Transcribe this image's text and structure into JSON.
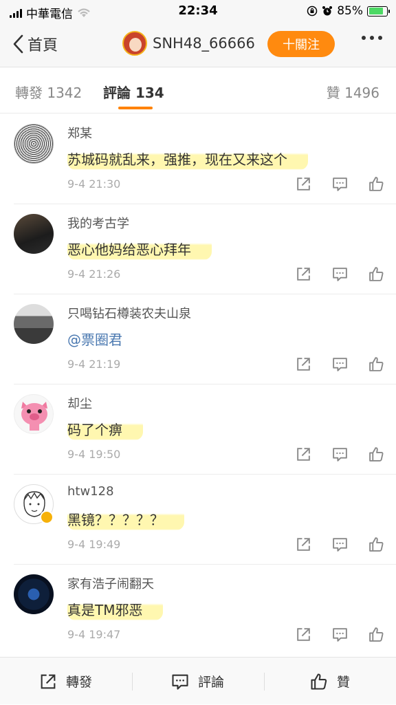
{
  "status_bar": {
    "carrier": "中華電信",
    "time": "22:34",
    "battery": "85%"
  },
  "nav": {
    "back_label": "首頁",
    "username": "SNH48_66666",
    "follow_label": "十關注"
  },
  "tabs": [
    {
      "label": "轉發 1342"
    },
    {
      "label": "評論 134"
    },
    {
      "label": "贊 1496"
    }
  ],
  "comments": [
    {
      "name": "郑某",
      "text": "苏城码就乱来，强推，现在又来这个",
      "time": "9-4 21:30"
    },
    {
      "name": "我的考古学",
      "text": "恶心他妈给恶心拜年",
      "time": "9-4 21:26"
    },
    {
      "name": "只喝钻石樽装农夫山泉",
      "text": "@票圈君",
      "time": "9-4 21:19"
    },
    {
      "name": "却尘",
      "text": "码了个痹",
      "time": "9-4 19:50"
    },
    {
      "name": "htw128",
      "text": "黑镜？？？？？",
      "time": "9-4 19:49"
    },
    {
      "name": "家有浩子闹翻天",
      "text": "真是TM邪恶",
      "time": "9-4 19:47"
    }
  ],
  "bottom_bar": {
    "repost": "轉發",
    "comment": "評論",
    "like": "贊"
  },
  "colors": {
    "accent": "#ff8200",
    "follow": "#ff8a0f",
    "mention": "#4a78b0"
  }
}
